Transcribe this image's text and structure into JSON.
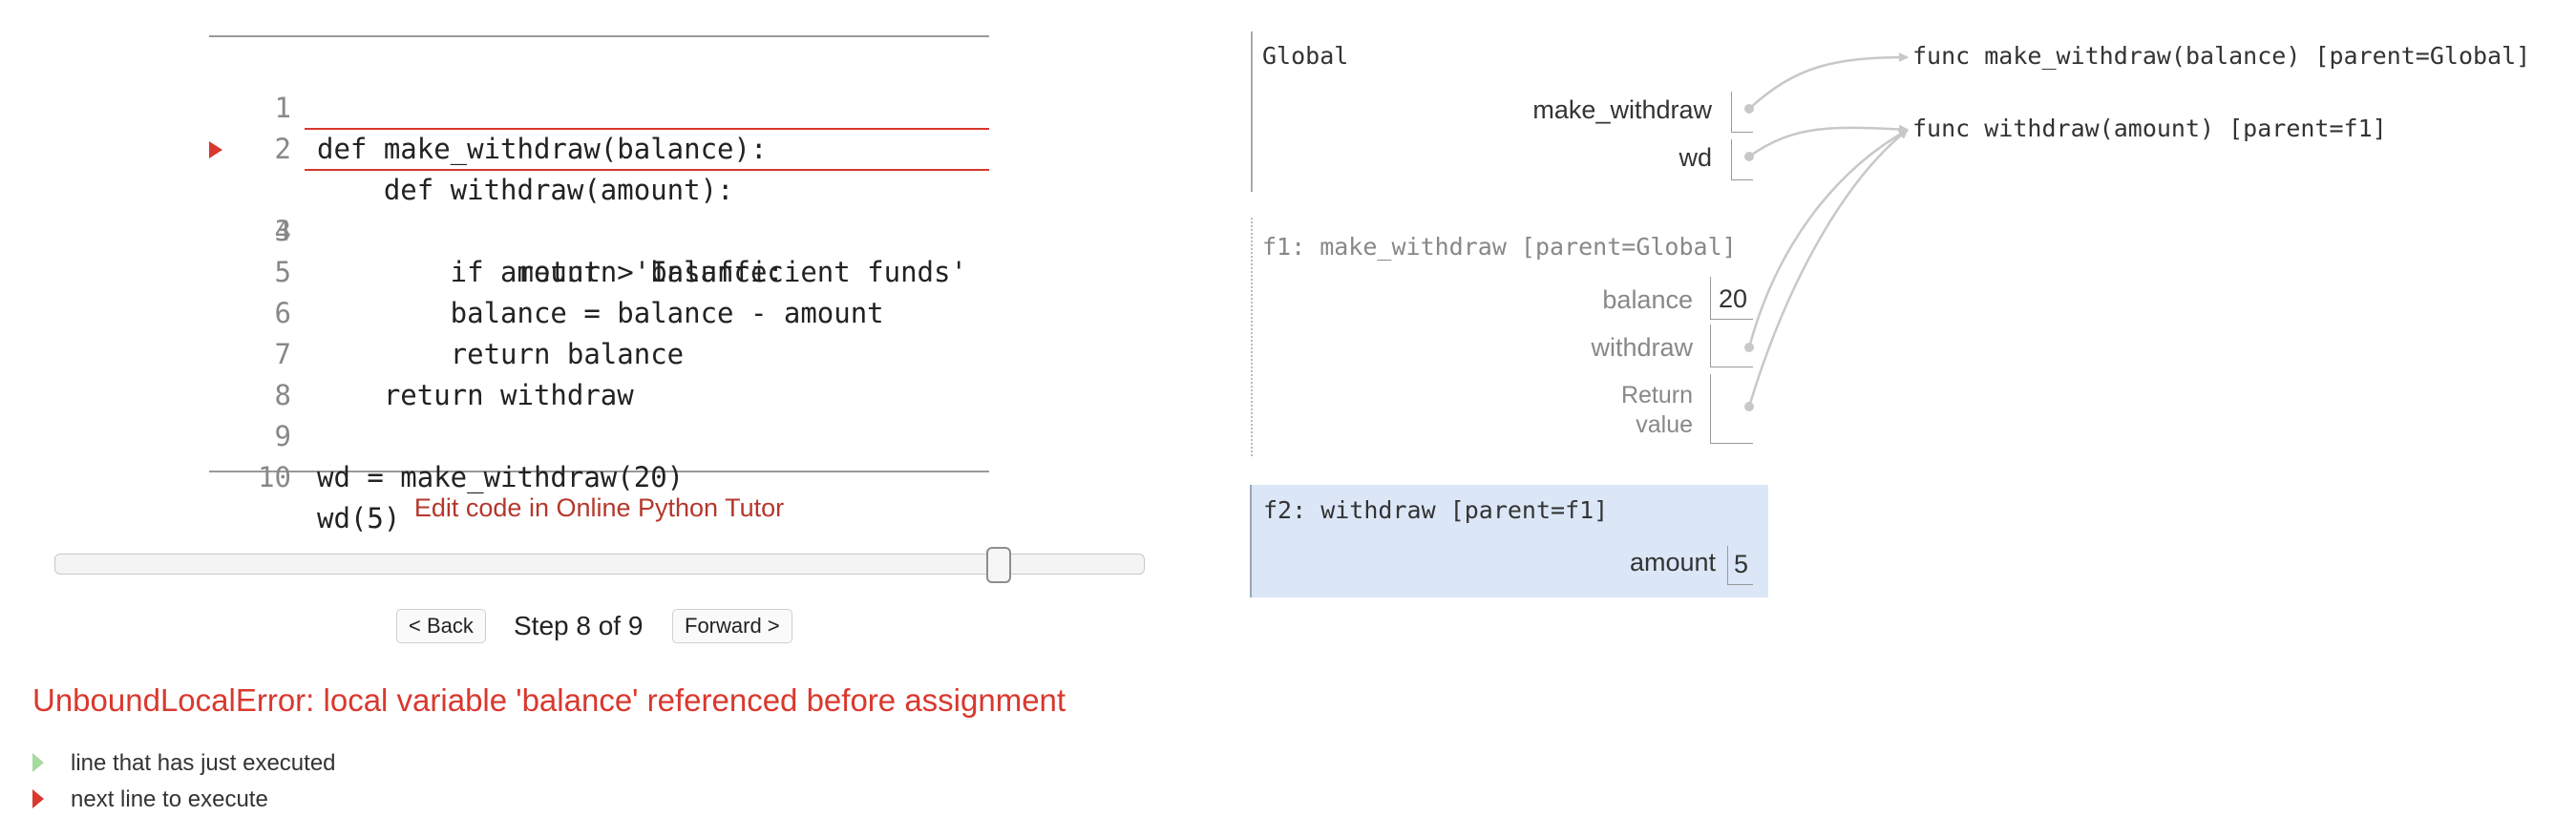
{
  "code": {
    "lines": [
      {
        "num": "1",
        "text": "def make_withdraw(balance):"
      },
      {
        "num": "2",
        "text": "    def withdraw(amount):"
      },
      {
        "num": "3",
        "text": "        if amount > balance:"
      },
      {
        "num": "4",
        "text": "            return 'Insufficient funds'"
      },
      {
        "num": "5",
        "text": "        balance = balance - amount"
      },
      {
        "num": "6",
        "text": "        return balance"
      },
      {
        "num": "7",
        "text": "    return withdraw"
      },
      {
        "num": "8",
        "text": ""
      },
      {
        "num": "9",
        "text": "wd = make_withdraw(20)"
      },
      {
        "num": "10",
        "text": "wd(5)"
      }
    ],
    "next_line": 3
  },
  "controls": {
    "edit_link": "Edit code in Online Python Tutor",
    "back": "< Back",
    "forward": "Forward >",
    "step": "Step 8 of 9",
    "step_current": 8,
    "step_total": 9
  },
  "error": "UnboundLocalError: local variable 'balance' referenced before assignment",
  "legend": {
    "executed": "line that has just executed",
    "next": "next line to execute"
  },
  "frames": {
    "global": {
      "title": "Global",
      "vars": [
        {
          "name": "make_withdraw"
        },
        {
          "name": "wd"
        }
      ]
    },
    "f1": {
      "title": "f1: make_withdraw [parent=Global]",
      "vars": [
        {
          "name": "balance",
          "value": "20"
        },
        {
          "name": "withdraw"
        },
        {
          "name": "Return\nvalue"
        }
      ]
    },
    "f2": {
      "title": "f2: withdraw [parent=f1]",
      "vars": [
        {
          "name": "amount",
          "value": "5"
        }
      ]
    }
  },
  "objects": {
    "func1": "func make_withdraw(balance) [parent=Global]",
    "func2": "func withdraw(amount) [parent=f1]"
  },
  "colors": {
    "next_arrow": "#d9382e",
    "executed_arrow": "#a6dba0",
    "error": "#d9382e",
    "link": "#b5372c",
    "active_frame": "#dbe7f7"
  }
}
